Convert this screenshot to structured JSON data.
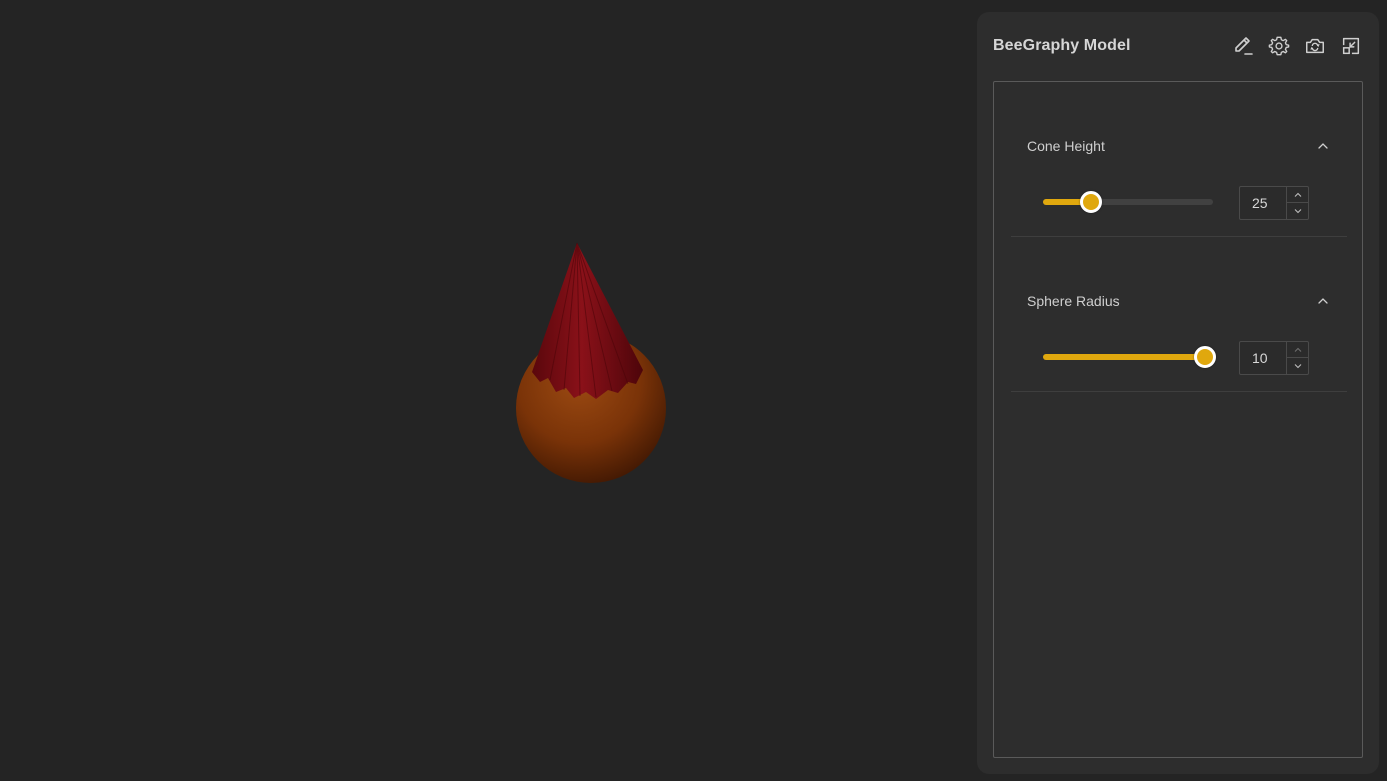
{
  "panel": {
    "title": "BeeGraphy Model",
    "icons": [
      "edit-icon",
      "settings-icon",
      "camera-switch-icon",
      "minimize-icon"
    ]
  },
  "parameters": [
    {
      "label": "Cone Height",
      "value": "25",
      "slider_fraction": 0.28
    },
    {
      "label": "Sphere Radius",
      "value": "10",
      "slider_fraction": 0.95
    }
  ],
  "colors": {
    "background": "#242424",
    "panel": "#2d2d2d",
    "accent": "#e0a80e",
    "cone": "#7a0f14",
    "sphere": "#8a3a0c"
  }
}
